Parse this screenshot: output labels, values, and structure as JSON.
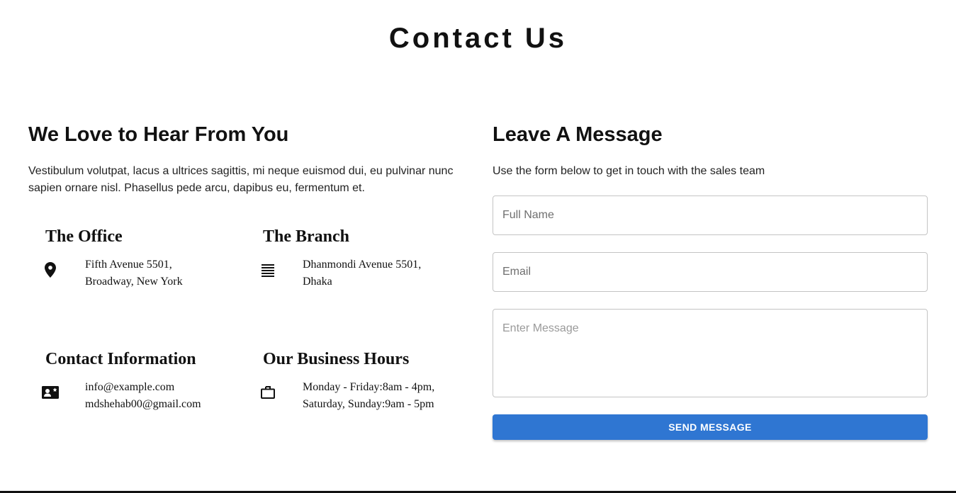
{
  "page": {
    "title": "Contact Us"
  },
  "left": {
    "heading": "We Love to Hear From You",
    "text": "Vestibulum volutpat, lacus a ultrices sagittis, mi neque euismod dui, eu pulvinar nunc sapien ornare nisl. Phasellus pede arcu, dapibus eu, fermentum et.",
    "blocks": [
      {
        "title": "The Office",
        "icon": "map-pin-icon",
        "lines": [
          "Fifth Avenue 5501,",
          "Broadway, New York"
        ]
      },
      {
        "title": "The Branch",
        "icon": "align-lines-icon",
        "lines": [
          "Dhanmondi Avenue 5501,",
          "Dhaka"
        ]
      },
      {
        "title": "Contact Information",
        "icon": "contact-card-icon",
        "lines": [
          "info@example.com",
          "mdshehab00@gmail.com"
        ]
      },
      {
        "title": "Our Business Hours",
        "icon": "briefcase-icon",
        "lines": [
          "Monday - Friday:8am - 4pm,",
          "Saturday, Sunday:9am - 5pm"
        ]
      }
    ]
  },
  "right": {
    "heading": "Leave A Message",
    "text": "Use the form below to get in touch with the sales team",
    "form": {
      "name_placeholder": "Full Name",
      "email_placeholder": "Email",
      "message_placeholder": "Enter Message",
      "submit_label": "SEND MESSAGE"
    }
  },
  "colors": {
    "accent": "#2f76d2",
    "text": "#111111",
    "border": "#c4c4c4"
  }
}
